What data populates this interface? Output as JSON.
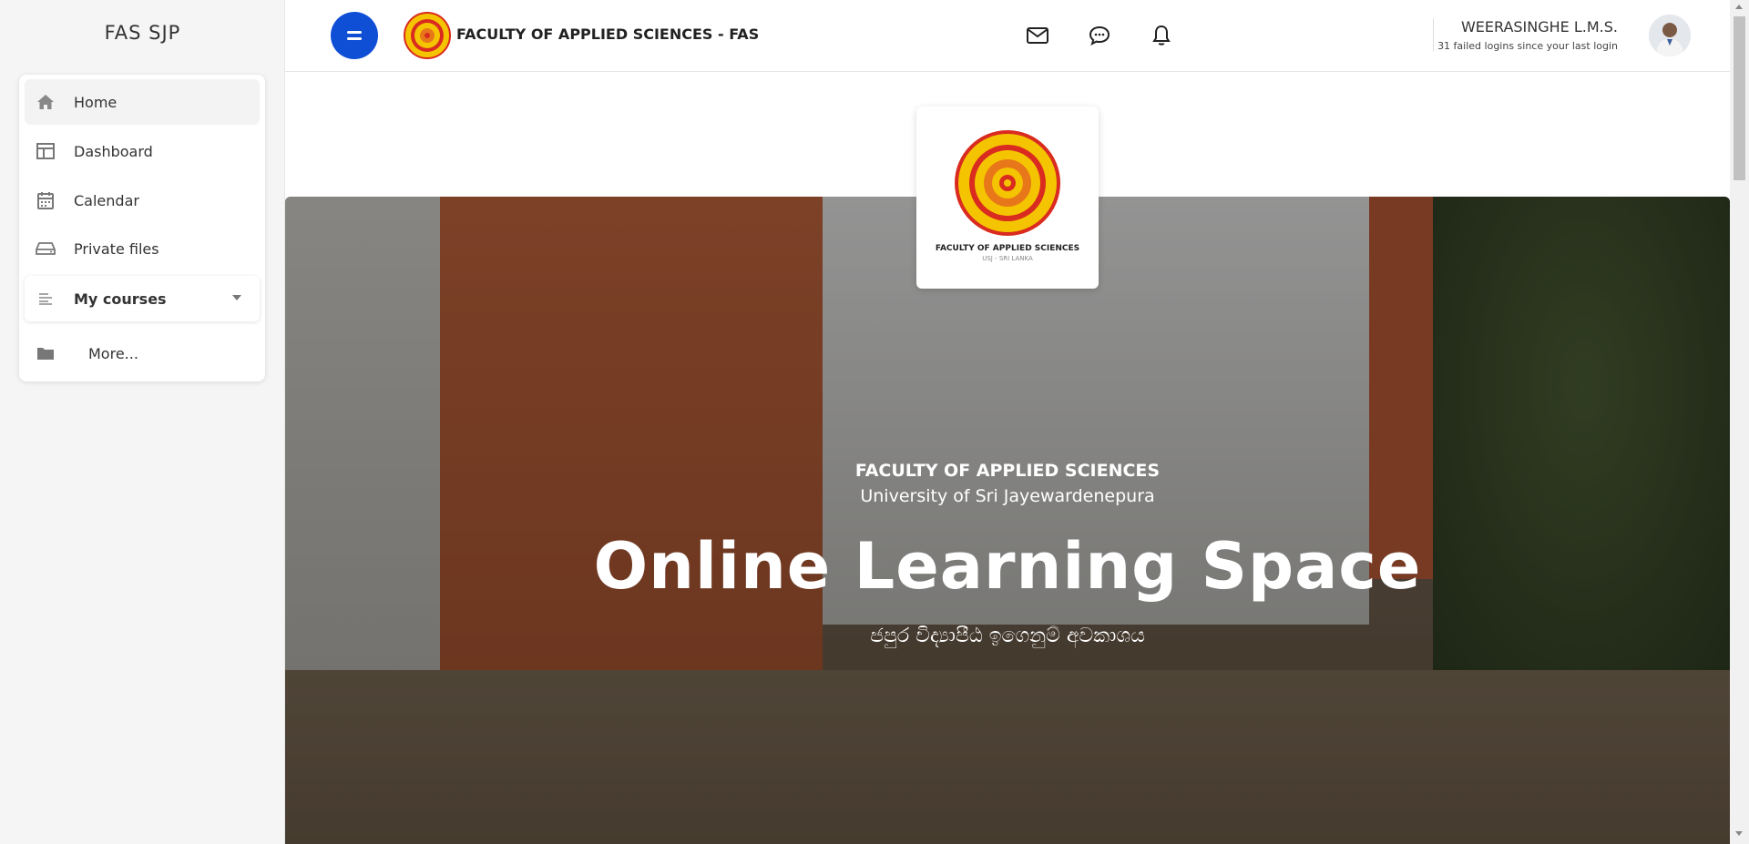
{
  "sidebar": {
    "brand": "FAS SJP",
    "items": [
      {
        "label": "Home",
        "icon": "home-icon"
      },
      {
        "label": "Dashboard",
        "icon": "dashboard-icon"
      },
      {
        "label": "Calendar",
        "icon": "calendar-icon"
      },
      {
        "label": "Private files",
        "icon": "drive-icon"
      },
      {
        "label": "My courses",
        "icon": "list-icon"
      },
      {
        "label": "More...",
        "icon": "folder-icon"
      }
    ]
  },
  "header": {
    "site_name": "FACULTY OF APPLIED SCIENCES - FAS",
    "user_name": "WEERASINGHE L.M.S.",
    "login_notice": "31 failed logins since your last login"
  },
  "logo_card": {
    "caption": "FACULTY OF APPLIED SCIENCES",
    "subcaption": "USJ - SRI LANKA"
  },
  "hero": {
    "line1": "FACULTY OF APPLIED SCIENCES",
    "line2": "University of Sri Jayewardenepura",
    "title": "Online Learning Space",
    "sinhala": "ජපුර විද්‍යාපීඨ ඉගෙනුම් අවකාශය"
  },
  "colors": {
    "accent": "#0f4fd6",
    "logo_yellow": "#f5c400",
    "logo_red": "#d92b1f"
  }
}
